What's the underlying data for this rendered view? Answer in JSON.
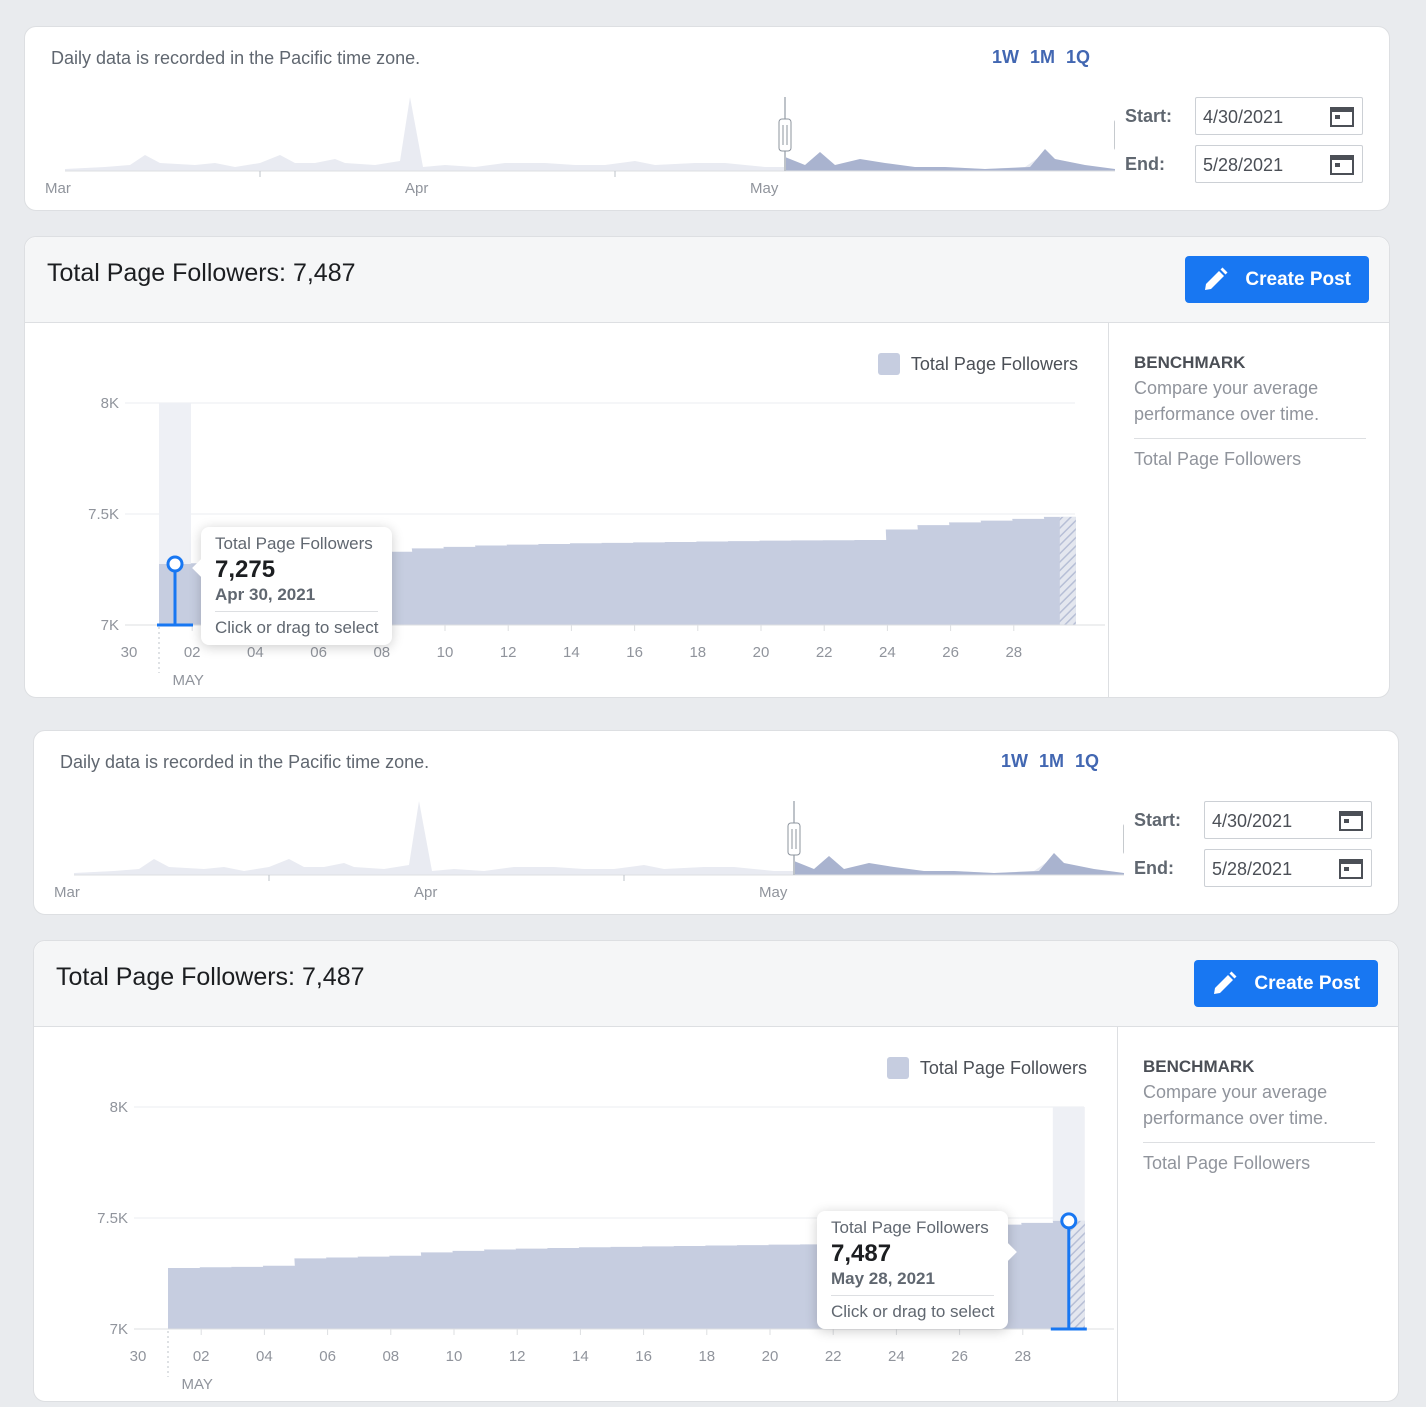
{
  "range_card": {
    "timezone_note": "Daily data is recorded in the Pacific time zone.",
    "tabs": [
      "1W",
      "1M",
      "1Q"
    ],
    "overview_months": [
      "Mar",
      "Apr",
      "May"
    ],
    "start_label": "Start:",
    "start_value": "4/30/2021",
    "end_label": "End:",
    "end_value": "5/28/2021"
  },
  "main_card": {
    "title": "Total Page Followers: 7,487",
    "create_post_label": "Create Post",
    "legend_label": "Total Page Followers"
  },
  "benchmark": {
    "title": "BENCHMARK",
    "description": "Compare your average performance over time.",
    "item": "Total Page Followers"
  },
  "chart_data": {
    "type": "area",
    "title": "Total Page Followers",
    "ylabel": "",
    "xlabel": "",
    "y_ticks": [
      "8K",
      "7.5K",
      "7K"
    ],
    "ylim": [
      7000,
      8000
    ],
    "x_ticks": [
      "30",
      "02",
      "04",
      "06",
      "08",
      "10",
      "12",
      "14",
      "16",
      "18",
      "20",
      "22",
      "24",
      "26",
      "28"
    ],
    "x_month_label": "MAY",
    "series": [
      {
        "name": "Total Page Followers",
        "color": "#c6cde0",
        "x": [
          "4/30",
          "5/1",
          "5/2",
          "5/3",
          "5/4",
          "5/5",
          "5/6",
          "5/7",
          "5/8",
          "5/9",
          "5/10",
          "5/11",
          "5/12",
          "5/13",
          "5/14",
          "5/15",
          "5/16",
          "5/17",
          "5/18",
          "5/19",
          "5/20",
          "5/21",
          "5/22",
          "5/23",
          "5/24",
          "5/25",
          "5/26",
          "5/27",
          "5/28"
        ],
        "values": [
          7275,
          7278,
          7280,
          7285,
          7318,
          7322,
          7326,
          7330,
          7345,
          7352,
          7358,
          7362,
          7365,
          7368,
          7370,
          7372,
          7374,
          7376,
          7378,
          7380,
          7381,
          7382,
          7383,
          7430,
          7450,
          7462,
          7470,
          7478,
          7487
        ]
      }
    ],
    "grid": true
  },
  "views": [
    {
      "tooltip": {
        "title": "Total Page Followers",
        "value": "7,275",
        "date": "Apr 30, 2021",
        "hint": "Click or drag to select"
      }
    },
    {
      "tooltip": {
        "title": "Total Page Followers",
        "value": "7,487",
        "date": "May 28, 2021",
        "hint": "Click or drag to select"
      }
    }
  ]
}
